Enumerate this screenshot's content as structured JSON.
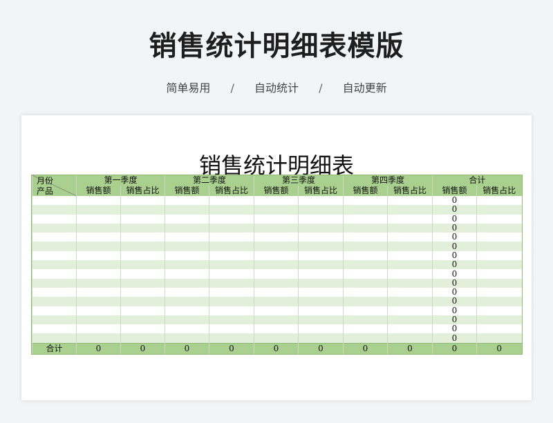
{
  "banner": {
    "title": "销售统计明细表模版",
    "tags": [
      "简单易用",
      "自动统计",
      "自动更新"
    ],
    "separator": "/"
  },
  "document": {
    "title": "销售统计明细表",
    "corner_top": "月份",
    "corner_bottom": "产品",
    "quarters": [
      "第一季度",
      "第二季度",
      "第三季度",
      "第四季度",
      "合计"
    ],
    "sub_headers": [
      "销售额",
      "销售占比"
    ],
    "rows": [
      {
        "total_sales": "0"
      },
      {
        "total_sales": "0"
      },
      {
        "total_sales": "0"
      },
      {
        "total_sales": "0"
      },
      {
        "total_sales": "0"
      },
      {
        "total_sales": "0"
      },
      {
        "total_sales": "0"
      },
      {
        "total_sales": "0"
      },
      {
        "total_sales": "0"
      },
      {
        "total_sales": "0"
      },
      {
        "total_sales": "0"
      },
      {
        "total_sales": "0"
      },
      {
        "total_sales": "0"
      },
      {
        "total_sales": "0"
      },
      {
        "total_sales": "0"
      },
      {
        "total_sales": "0"
      }
    ],
    "total_row": {
      "label": "合计",
      "values": [
        "0",
        "0",
        "0",
        "0",
        "0",
        "0",
        "0",
        "0",
        "0",
        "0"
      ]
    }
  },
  "colors": {
    "header_green": "#a9d08e",
    "stripe_green": "#e2efda"
  }
}
